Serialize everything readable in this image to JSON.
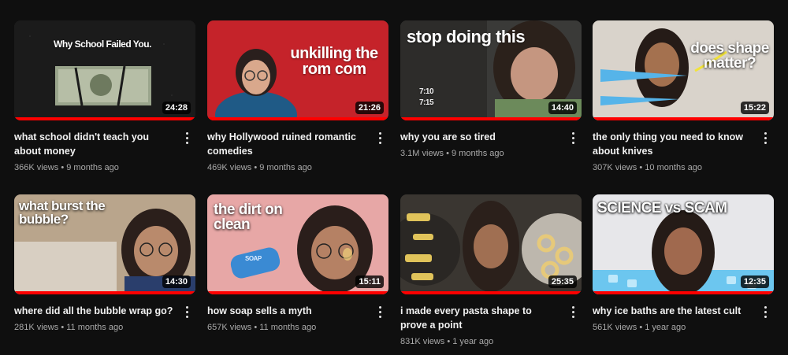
{
  "videos": [
    {
      "title": "what school didn't teach you about money",
      "views": "366K views",
      "age": "9 months ago",
      "duration": "24:28",
      "progress": 1.0,
      "thumb_text": "Why School Failed You."
    },
    {
      "title": "why Hollywood ruined romantic comedies",
      "views": "469K views",
      "age": "9 months ago",
      "duration": "21:26",
      "progress": 1.0,
      "thumb_text": "unkilling the rom com"
    },
    {
      "title": "why you are so tired",
      "views": "3.1M views",
      "age": "9 months ago",
      "duration": "14:40",
      "progress": 1.0,
      "thumb_text": "stop doing this",
      "thumb_text_2": "7:10",
      "thumb_text_3": "7:15"
    },
    {
      "title": "the only thing you need to know about knives",
      "views": "307K views",
      "age": "10 months ago",
      "duration": "15:22",
      "progress": 1.0,
      "thumb_text": "does shape matter?"
    },
    {
      "title": "where did all the bubble wrap go?",
      "views": "281K views",
      "age": "11 months ago",
      "duration": "14:30",
      "progress": 1.0,
      "thumb_text": "what burst the bubble?"
    },
    {
      "title": "how soap sells a myth",
      "views": "657K views",
      "age": "11 months ago",
      "duration": "15:11",
      "progress": 1.0,
      "thumb_text": "the dirt on clean",
      "thumb_text_2": "SOAP"
    },
    {
      "title": "i made every pasta shape to prove a point",
      "views": "831K views",
      "age": "1 year ago",
      "duration": "25:35",
      "progress": 1.0
    },
    {
      "title": "why ice baths are the latest cult",
      "views": "561K views",
      "age": "1 year ago",
      "duration": "12:35",
      "progress": 1.0,
      "thumb_text": "SCIENCE vs SCAM"
    }
  ],
  "stats_separator": " • ",
  "colors": {
    "background": "#0f0f0f",
    "progress": "#ff0000",
    "muted_text": "#aaaaaa"
  },
  "icons": {
    "more": "more-vert-icon"
  }
}
